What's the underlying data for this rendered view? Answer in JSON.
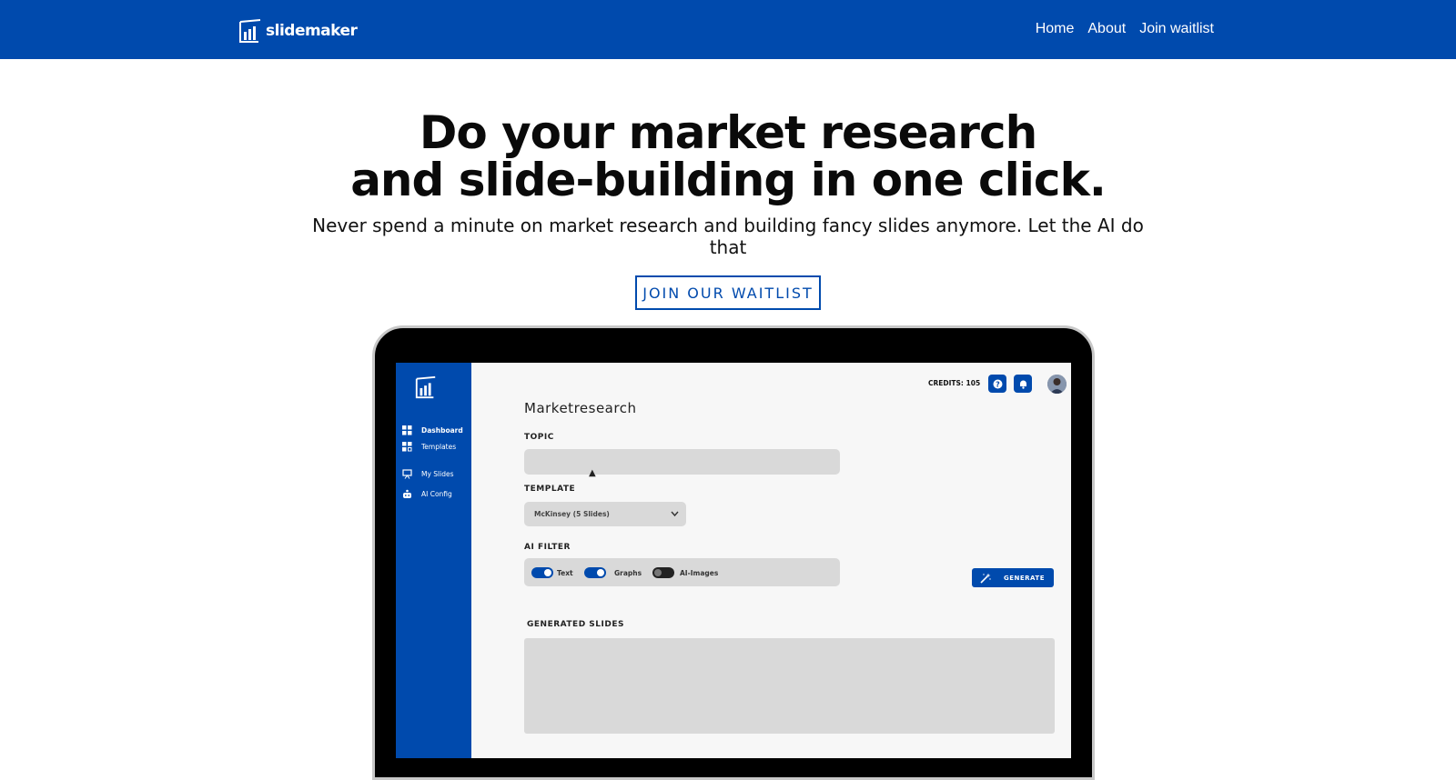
{
  "header": {
    "logo_text": "slidemaker",
    "nav": [
      {
        "label": "Home"
      },
      {
        "label": "About"
      },
      {
        "label": "Join waitlist"
      }
    ]
  },
  "hero": {
    "title_line1": "Do your market research",
    "title_line2": "and slide-building in one click.",
    "subtitle": "Never spend a minute on market research and building fancy slides anymore. Let the AI do that",
    "cta_label": "JOIN OUR WAITLIST"
  },
  "app": {
    "sidebar": [
      {
        "label": "Dashboard",
        "icon": "grid-icon"
      },
      {
        "label": "Templates",
        "icon": "templates-icon"
      },
      {
        "label": "My Slides",
        "icon": "presentation-icon"
      },
      {
        "label": "AI Config",
        "icon": "robot-icon"
      }
    ],
    "credits": "CREDITS: 105",
    "title": "Marketresearch",
    "topic_label": "TOPIC",
    "topic_value": "",
    "template_label": "TEMPLATE",
    "template_value": "McKinsey (5 Slides)",
    "filter_label": "AI FILTER",
    "filters": [
      {
        "label": "Text",
        "on": true
      },
      {
        "label": "Graphs",
        "on": true
      },
      {
        "label": "AI-Images",
        "on": false
      }
    ],
    "generate_label": "GENERATE",
    "generated_label": "GENERATED SLIDES"
  },
  "colors": {
    "brand": "#004aad",
    "background": "#ffffff",
    "field": "#d9d9d9"
  }
}
